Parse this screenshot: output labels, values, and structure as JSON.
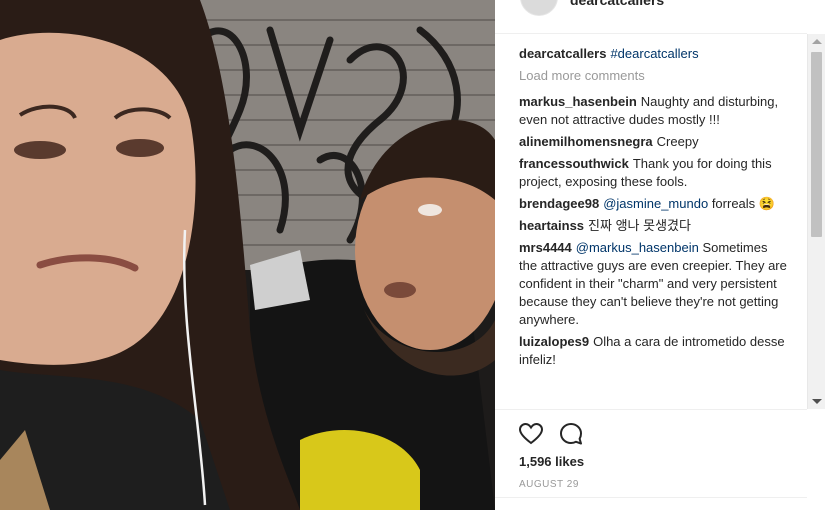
{
  "post": {
    "author": "dearcatcallers",
    "caption": {
      "user": "dearcatcallers",
      "hashtag": "#dearcatcallers"
    },
    "load_more_label": "Load more comments",
    "comments": [
      {
        "user": "markus_hasenbein",
        "text": "Naughty and disturbing, even not attractive dudes mostly !!!"
      },
      {
        "user": "alinemilhomensnegra",
        "text": "Creepy"
      },
      {
        "user": "francessouthwick",
        "text": "Thank you for doing this project, exposing these fools."
      },
      {
        "user": "brendagee98",
        "mention": "@jasmine_mundo",
        "text": "forreals 😫"
      },
      {
        "user": "heartainss",
        "text": "진짜 앵나 못생겼다"
      },
      {
        "user": "mrs4444",
        "mention": "@markus_hasenbein",
        "text": "Sometimes the attractive guys are even creepier. They are confident in their \"charm\" and very persistent because they can't believe they're not getting anywhere."
      },
      {
        "user": "luizalopes9",
        "text": "Olha a cara de intrometido desse infeliz!"
      }
    ],
    "likes_label": "1,596 likes",
    "date_label": "AUGUST 29"
  },
  "icons": {
    "like": "heart-outline-icon",
    "comment": "speech-bubble-icon"
  },
  "colors": {
    "text": "#262626",
    "muted": "#999999",
    "link": "#003569",
    "border": "#efefef"
  }
}
